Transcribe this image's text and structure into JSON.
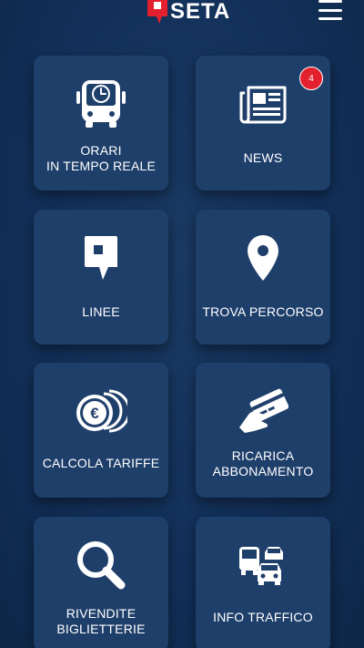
{
  "header": {
    "logo_text": "SETA",
    "menu_icon": "hamburger-menu-icon"
  },
  "colors": {
    "background": "#12305a",
    "tile": "#1f3f6b",
    "brand_red": "#e3202d",
    "text": "#ffffff"
  },
  "tiles": [
    {
      "label": "ORARI\nIN TEMPO REALE",
      "icon": "bus-clock-icon"
    },
    {
      "label": "NEWS",
      "icon": "newspaper-icon",
      "badge": "4"
    },
    {
      "label": "LINEE",
      "icon": "bus-stop-sign-icon"
    },
    {
      "label": "TROVA PERCORSO",
      "icon": "map-pin-icon"
    },
    {
      "label": "CALCOLA TARIFFE",
      "icon": "euro-coins-icon"
    },
    {
      "label": "RICARICA\nABBONAMENTO",
      "icon": "card-in-hand-icon"
    },
    {
      "label": "RIVENDITE\nBIGLIETTERIE",
      "icon": "magnifier-icon"
    },
    {
      "label": "INFO TRAFFICO",
      "icon": "traffic-vehicles-icon"
    }
  ]
}
